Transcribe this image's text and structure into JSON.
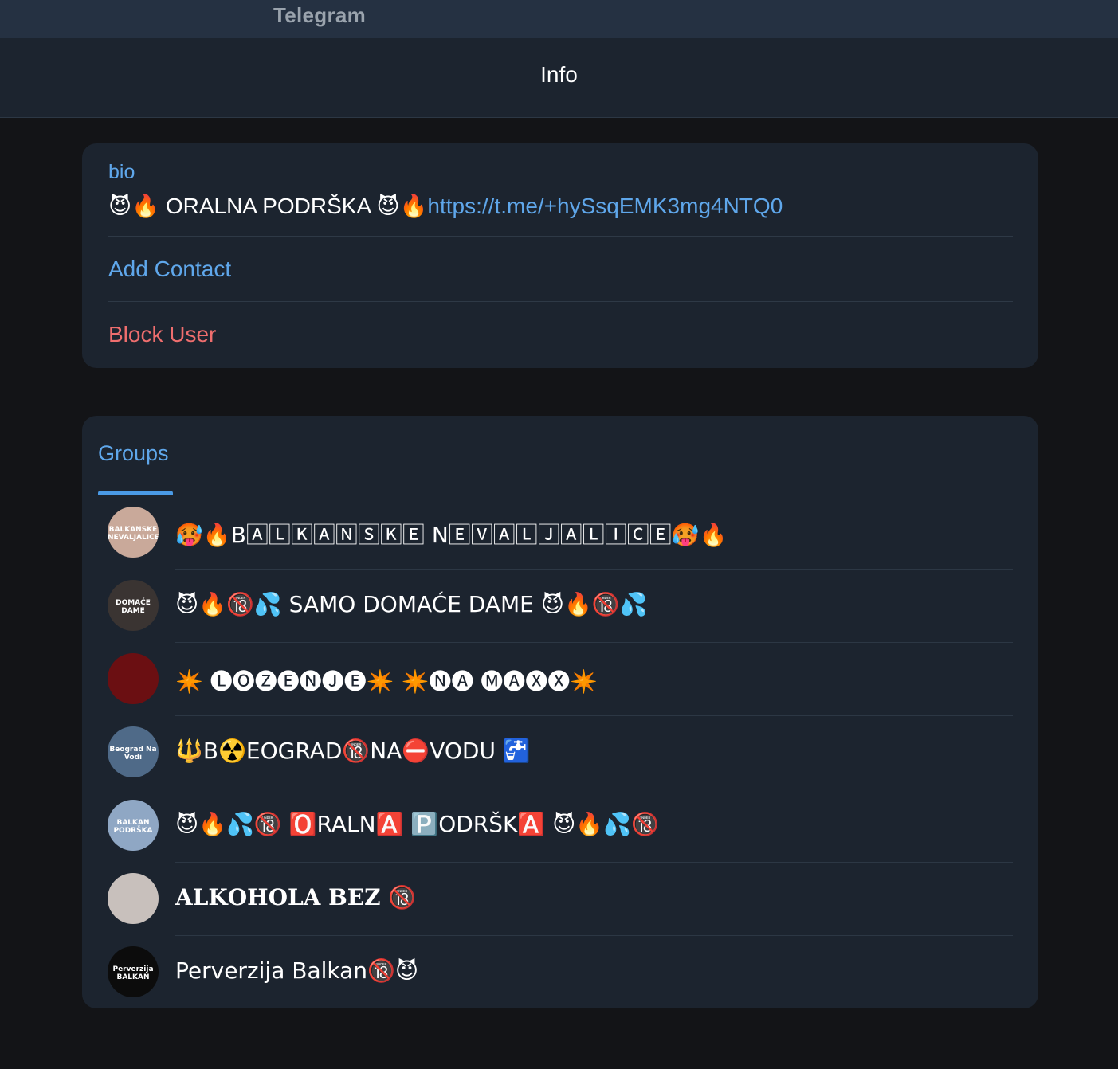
{
  "window": {
    "app_title": "Telegram"
  },
  "header": {
    "title": "Info"
  },
  "info": {
    "bio_label": "bio",
    "bio_text": "😈🔥 ORALNA PODRŠKA 😈🔥",
    "bio_link": "https://t.me/+hySsqEMK3mg4NTQ0",
    "add_contact": "Add Contact",
    "block_user": "Block User"
  },
  "groups": {
    "tab_label": "Groups",
    "items": [
      {
        "name": "🥵🔥B🄰🄻🄺🄰🄽🅂🄺🄴 N🄴🅅🄰🄻🄹🄰🄻🄸🄲🄴🥵🔥",
        "avatar_text": "BALKANSKE NEVALJALICE",
        "avatar_color": "#c9a99a"
      },
      {
        "name": "😈🔥🔞💦 SAMO DOMAĆE DAME 😈🔥🔞💦",
        "avatar_text": "DOMAĆE DAME",
        "avatar_color": "#3a3432"
      },
      {
        "name": "✴️ 🅛🅞🅩🅔🅝🅙🅔✴️ ✴️🅝🅐 🅜🅐🅧🅧✴️",
        "avatar_text": "",
        "avatar_color": "#6b0f12"
      },
      {
        "name": "🔱B☢️EOGRAD🔞NA⛔VODU 🚰",
        "avatar_text": "Beograd Na Vodi",
        "avatar_color": "#4f6a88"
      },
      {
        "name": "😈🔥💦🔞 🅾️RALN🅰️ 🅿️ODRŠK🅰️ 😈🔥💦🔞",
        "avatar_text": "BALKAN PODRŠKA",
        "avatar_color": "#8fa7c4"
      },
      {
        "name": "𝐀𝐋𝐊𝐎𝐇𝐎𝐋𝐀 𝐁𝐄𝐙 🔞",
        "avatar_text": "",
        "avatar_color": "#c8c0bc"
      },
      {
        "name": "Perverzija Balkan🔞😈",
        "avatar_text": "Perverzija BALKAN",
        "avatar_color": "#0c0c0c"
      }
    ]
  }
}
